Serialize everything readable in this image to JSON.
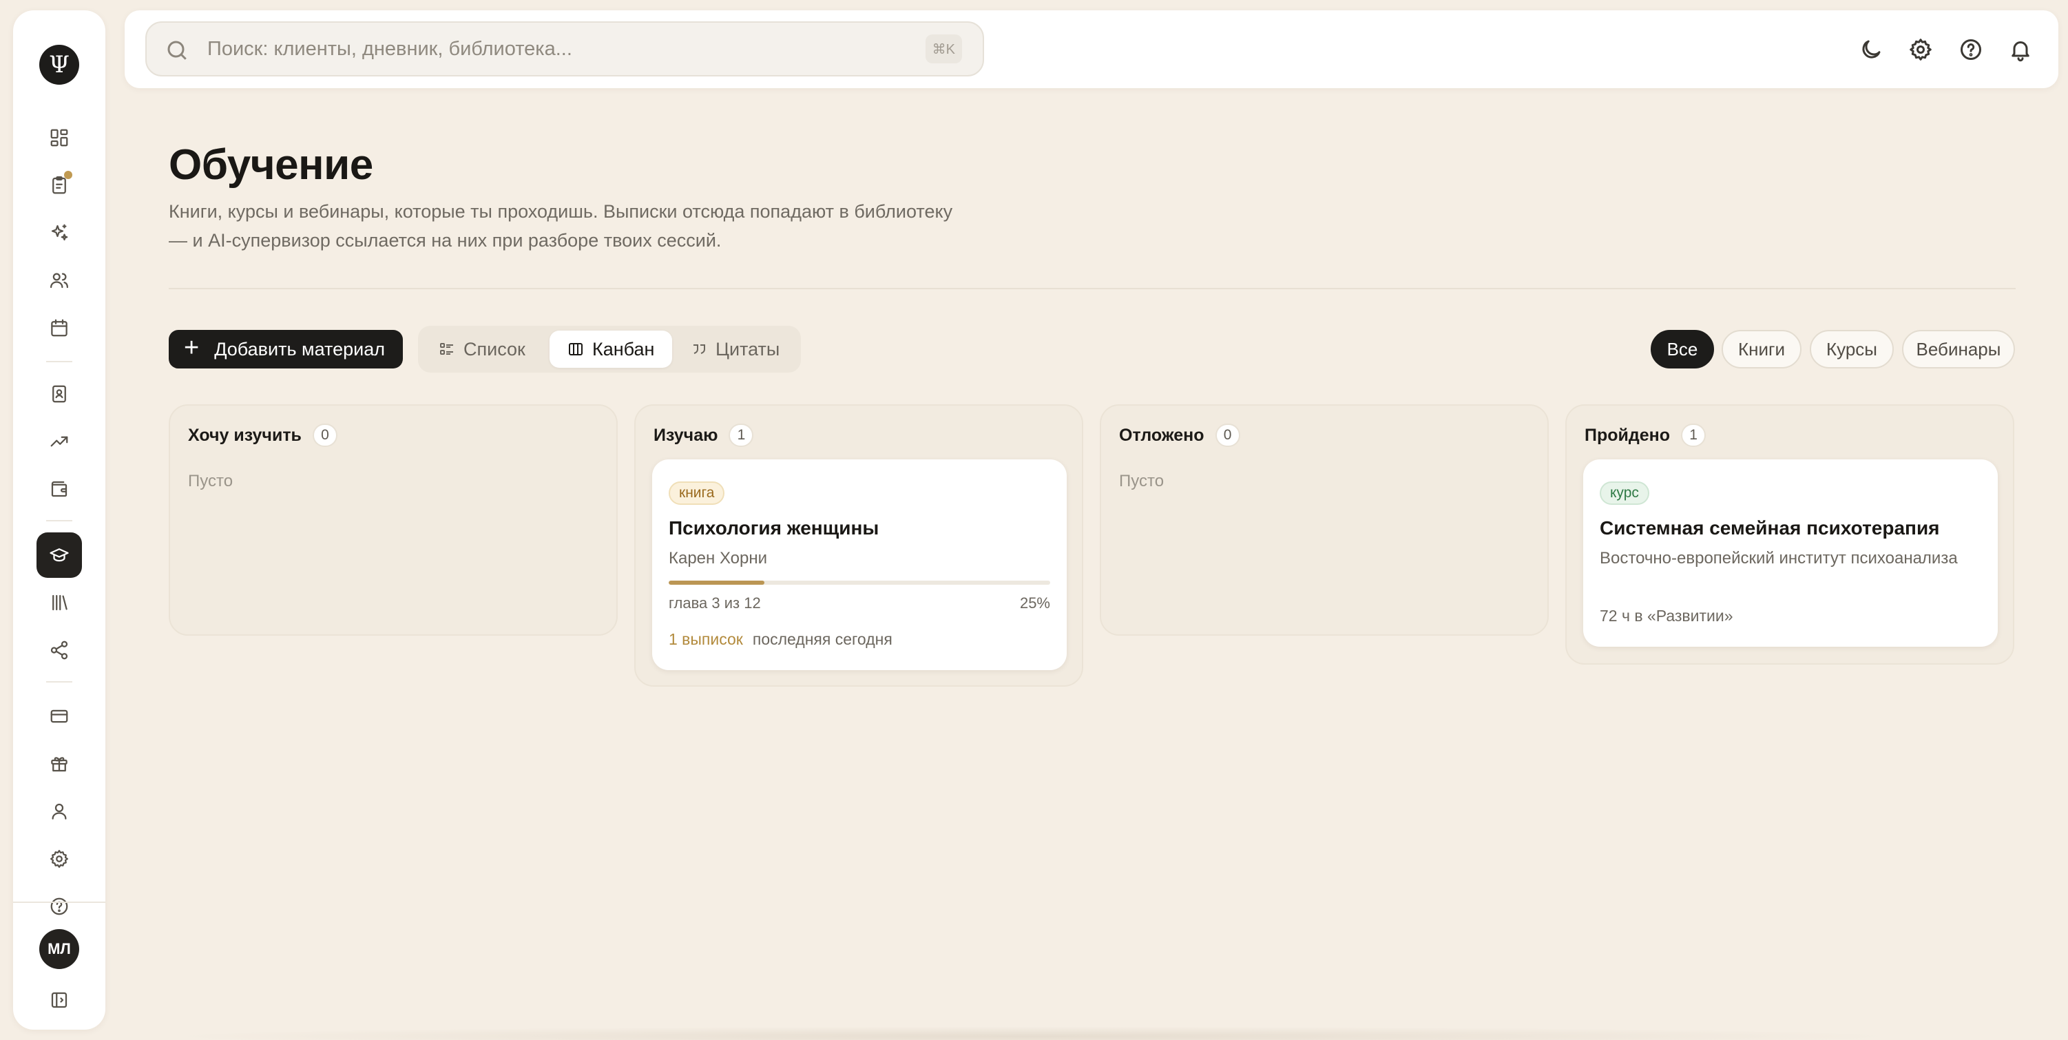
{
  "sidebar": {
    "logo": "Ψ",
    "items": [
      {
        "name": "dashboard-icon"
      },
      {
        "name": "clipboard-icon",
        "badge": true
      },
      {
        "name": "sparkles-icon"
      },
      {
        "name": "users-icon"
      },
      {
        "name": "calendar-icon"
      },
      {
        "name": "notebook-icon"
      },
      {
        "name": "trending-icon"
      },
      {
        "name": "wallet-icon"
      },
      {
        "name": "graduation-cap-icon",
        "active": true
      },
      {
        "name": "library-icon"
      },
      {
        "name": "share-icon"
      },
      {
        "name": "credit-card-icon"
      },
      {
        "name": "gift-icon"
      },
      {
        "name": "user-icon"
      },
      {
        "name": "settings-icon"
      },
      {
        "name": "help-icon"
      }
    ],
    "avatar_initials": "МЛ"
  },
  "topbar": {
    "search_placeholder": "Поиск: клиенты, дневник, библиотека...",
    "shortcut": "⌘K"
  },
  "page": {
    "title": "Обучение",
    "description": "Книги, курсы и вебинары, которые ты проходишь. Выписки отсюда попадают в библиотеку — и AI-супервизор ссылается на них при разборе твоих сессий."
  },
  "toolbar": {
    "add_label": "Добавить материал",
    "views": [
      "Список",
      "Канбан",
      "Цитаты"
    ],
    "active_view": "Канбан",
    "filters": [
      "Все",
      "Книги",
      "Курсы",
      "Вебинары"
    ],
    "active_filter": "Все"
  },
  "board": {
    "columns": [
      {
        "title": "Хочу изучить",
        "count": "0",
        "empty_text": "Пусто"
      },
      {
        "title": "Изучаю",
        "count": "1",
        "card": {
          "tag": "книга",
          "title": "Психология женщины",
          "author": "Карен Хорни",
          "progress": 0.25,
          "progress_label": "глава 3 из 12",
          "progress_pct": "25%",
          "notes": "1 выписок",
          "last": "последняя сегодня"
        }
      },
      {
        "title": "Отложено",
        "count": "0",
        "empty_text": "Пусто"
      },
      {
        "title": "Пройдено",
        "count": "1",
        "card": {
          "tag": "курс",
          "title": "Системная семейная психотерапия",
          "author": "Восточно-европейский институт психоанализа",
          "hours": "72 ч в «Развитии»"
        }
      }
    ]
  },
  "colors": {
    "background": "#f5eee4",
    "accent": "#bb9654",
    "dark": "#1d1c1a"
  }
}
